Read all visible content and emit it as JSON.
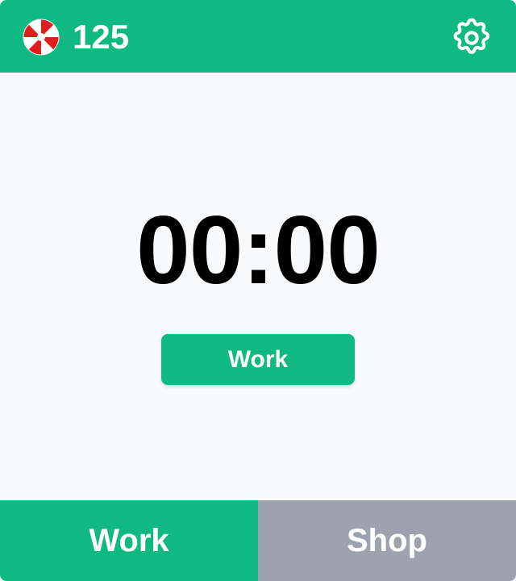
{
  "header": {
    "candy_icon": "peppermint-candy-icon",
    "candy_count": "125",
    "settings_icon": "gear-icon"
  },
  "timer": {
    "display": "00:00"
  },
  "action_button": {
    "label": "Work"
  },
  "tabs": [
    {
      "label": "Work",
      "active": true
    },
    {
      "label": "Shop",
      "active": false
    }
  ],
  "colors": {
    "accent": "#10b981",
    "inactive_tab": "#9ca3af",
    "background": "#f8fafc",
    "candy_red": "#e11d1d"
  }
}
